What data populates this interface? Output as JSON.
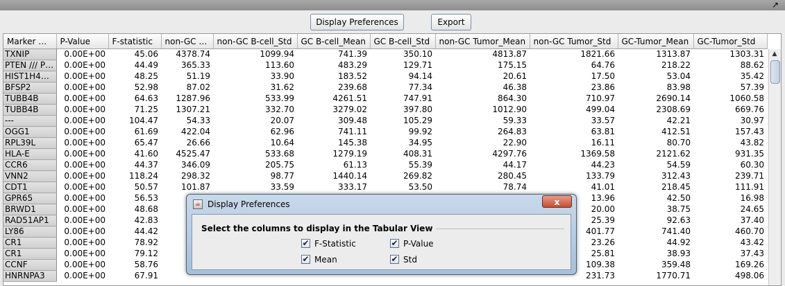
{
  "toolbar": {
    "display_preferences": "Display Preferences",
    "export": "Export"
  },
  "icons": {
    "maximize": "↗",
    "scroll_up": "▲",
    "close": "x",
    "checkmark": "✔"
  },
  "table": {
    "columns": [
      "Marker Na...",
      "P-Value",
      "F-statistic",
      "non-GC B...",
      "non-GC B-cell_Std",
      "GC B-cell_Mean",
      "GC B-cell_Std",
      "non-GC Tumor_Mean",
      "non-GC Tumor_Std",
      "GC-Tumor_Mean",
      "GC-Tumor_Std"
    ],
    "rows": [
      [
        "TXNIP",
        "0.00E+00",
        "45.06",
        "4378.74",
        "1099.94",
        "741.39",
        "350.10",
        "4813.87",
        "1821.66",
        "1313.87",
        "1303.31"
      ],
      [
        "PTEN /// PT...",
        "0.00E+00",
        "44.49",
        "365.33",
        "113.60",
        "483.29",
        "129.71",
        "175.15",
        "64.76",
        "218.22",
        "88.62"
      ],
      [
        "HIST1H4A ...",
        "0.00E+00",
        "48.25",
        "51.19",
        "33.90",
        "183.52",
        "94.14",
        "20.61",
        "17.50",
        "53.04",
        "35.42"
      ],
      [
        "BFSP2",
        "0.00E+00",
        "52.98",
        "87.02",
        "31.62",
        "239.68",
        "77.34",
        "46.38",
        "23.86",
        "83.98",
        "57.39"
      ],
      [
        "TUBB4B",
        "0.00E+00",
        "64.63",
        "1287.96",
        "533.99",
        "4261.51",
        "747.91",
        "864.30",
        "710.97",
        "2690.14",
        "1060.58"
      ],
      [
        "TUBB4B",
        "0.00E+00",
        "71.25",
        "1307.21",
        "332.70",
        "3279.02",
        "397.80",
        "1012.90",
        "499.04",
        "2308.69",
        "669.76"
      ],
      [
        "---",
        "0.00E+00",
        "104.47",
        "54.33",
        "20.07",
        "309.48",
        "105.29",
        "59.33",
        "33.57",
        "42.21",
        "30.97"
      ],
      [
        "OGG1",
        "0.00E+00",
        "61.69",
        "422.04",
        "62.96",
        "741.11",
        "99.92",
        "264.83",
        "63.81",
        "412.51",
        "157.43"
      ],
      [
        "RPL39L",
        "0.00E+00",
        "65.47",
        "26.66",
        "10.64",
        "145.38",
        "34.95",
        "22.90",
        "16.11",
        "80.70",
        "43.82"
      ],
      [
        "HLA-E",
        "0.00E+00",
        "41.60",
        "4525.47",
        "533.68",
        "1279.19",
        "408.31",
        "4297.76",
        "1369.58",
        "2121.62",
        "931.35"
      ],
      [
        "CCR6",
        "0.00E+00",
        "44.37",
        "346.09",
        "205.75",
        "61.13",
        "55.39",
        "44.17",
        "44.23",
        "54.59",
        "60.30"
      ],
      [
        "VNN2",
        "0.00E+00",
        "118.24",
        "298.32",
        "98.77",
        "1440.14",
        "269.82",
        "280.45",
        "133.79",
        "312.43",
        "239.71"
      ],
      [
        "CDT1",
        "0.00E+00",
        "50.57",
        "101.87",
        "33.59",
        "333.17",
        "53.50",
        "78.74",
        "41.01",
        "218.45",
        "111.91"
      ],
      [
        "GPR65",
        "0.00E+00",
        "56.53",
        "",
        "",
        "",
        "",
        "",
        "13.96",
        "42.50",
        "16.98"
      ],
      [
        "BRWD1",
        "0.00E+00",
        "48.68",
        "",
        "",
        "",
        "",
        "",
        "20.00",
        "38.75",
        "24.65"
      ],
      [
        "RAD51AP1",
        "0.00E+00",
        "42.83",
        "",
        "",
        "",
        "",
        "",
        "25.39",
        "92.63",
        "37.40"
      ],
      [
        "LY86",
        "0.00E+00",
        "44.42",
        "",
        "",
        "",
        "",
        "",
        "401.77",
        "741.40",
        "460.70"
      ],
      [
        "CR1",
        "0.00E+00",
        "78.92",
        "",
        "",
        "",
        "",
        "",
        "23.26",
        "44.92",
        "43.42"
      ],
      [
        "CR1",
        "0.00E+00",
        "79.12",
        "",
        "",
        "",
        "",
        "",
        "25.81",
        "38.93",
        "37.43"
      ],
      [
        "CCNF",
        "0.00E+00",
        "58.76",
        "",
        "",
        "",
        "",
        "",
        "109.38",
        "359.48",
        "169.26"
      ],
      [
        "HNRNPA3",
        "0.00E+00",
        "67.91",
        "",
        "",
        "",
        "",
        "",
        "231.73",
        "1770.71",
        "498.06"
      ]
    ]
  },
  "dialog": {
    "title": "Display Preferences",
    "group_label": "Select the columns to display in the Tabular View",
    "options": {
      "f_statistic": {
        "label": "F-Statistic",
        "checked": true
      },
      "p_value": {
        "label": "P-Value",
        "checked": true
      },
      "mean": {
        "label": "Mean",
        "checked": true
      },
      "std": {
        "label": "Std",
        "checked": true
      }
    }
  }
}
